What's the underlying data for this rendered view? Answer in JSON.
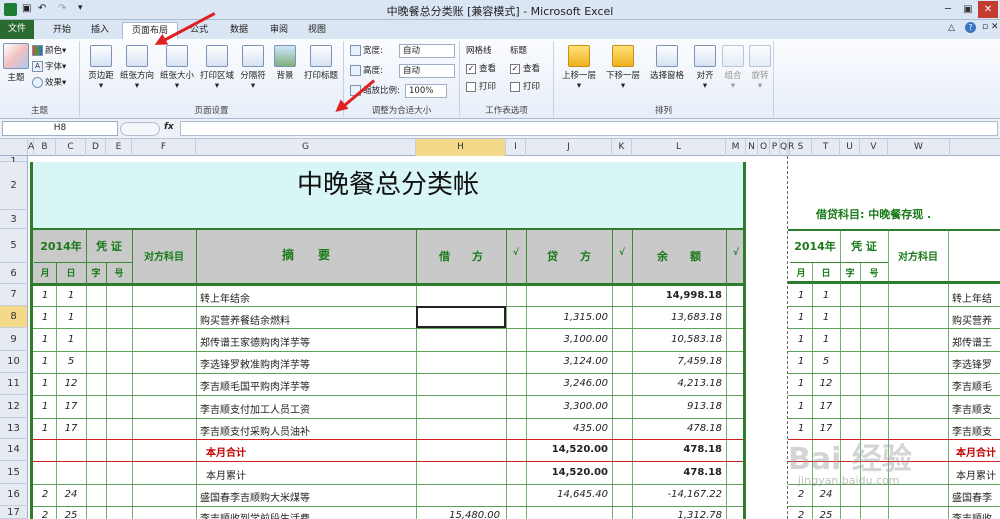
{
  "window": {
    "title": "中晚餐总分类账  [兼容模式]  -  Microsoft Excel"
  },
  "tabs": [
    "文件",
    "开始",
    "插入",
    "页面布局",
    "公式",
    "数据",
    "审阅",
    "视图"
  ],
  "ribbon": {
    "theme": {
      "big": "主题",
      "colors": "颜色",
      "fonts": "字体",
      "effects": "效果",
      "label": "主题"
    },
    "pagesetup": {
      "margins": "页边距",
      "orientation": "纸张方向",
      "size": "纸张大小",
      "printarea": "打印区域",
      "breaks": "分隔符",
      "background": "背景",
      "titles": "打印标题",
      "label": "页面设置"
    },
    "scale": {
      "width_label": "宽度:",
      "width_val": "自动",
      "height_label": "高度:",
      "height_val": "自动",
      "scale_label": "缩放比例:",
      "scale_val": "100%",
      "label": "调整为合适大小"
    },
    "sheetopts": {
      "grid": "网格线",
      "headings": "标题",
      "view1": "查看",
      "view2": "查看",
      "print1": "打印",
      "print2": "打印",
      "label": "工作表选项"
    },
    "arrange": {
      "up": "上移一层",
      "down": "下移一层",
      "pane": "选择窗格",
      "align": "对齐",
      "group": "组合",
      "rotate": "旋转",
      "label": "排列"
    }
  },
  "formula": {
    "namebox": "H8",
    "fx": "fx"
  },
  "columns": [
    "A",
    "B",
    "C",
    "D",
    "E",
    "F",
    "G",
    "H",
    "I",
    "J",
    "K",
    "L",
    "M",
    "N",
    "O",
    "P",
    "Q",
    "R",
    "S",
    "T",
    "U",
    "V",
    "W"
  ],
  "rows": [
    "1",
    "2",
    "3",
    "5",
    "6",
    "7",
    "8",
    "9",
    "10",
    "11",
    "12",
    "13",
    "14",
    "15",
    "16",
    "17"
  ],
  "sheet": {
    "title": "中晚餐总分类帐",
    "subject": "借贷科目:  中晚餐存现 .",
    "h_year": "2014年",
    "h_voucher": "凭 证",
    "h_counter": "对方科目",
    "h_summary": "摘　　要",
    "h_debit": "借　　方",
    "h_credit": "贷　　方",
    "h_balance": "余　　额",
    "h_check": "√",
    "h_month": "月",
    "h_day": "日",
    "h_zi": "字",
    "h_hao": "号",
    "r7": {
      "m": "1",
      "d": "1",
      "desc": "转上年结余",
      "bal": "14,998.18"
    },
    "r8": {
      "m": "1",
      "d": "1",
      "desc": "购买营养餐结余燃料",
      "cr": "1,315.00",
      "bal": "13,683.18"
    },
    "r9": {
      "m": "1",
      "d": "1",
      "desc": "郑传谱王家德购肉洋芋等",
      "cr": "3,100.00",
      "bal": "10,583.18"
    },
    "r10": {
      "m": "1",
      "d": "5",
      "desc": "李选锋罗敕准购肉洋芋等",
      "cr": "3,124.00",
      "bal": "7,459.18"
    },
    "r11": {
      "m": "1",
      "d": "12",
      "desc": "李吉顺毛国平购肉洋芋等",
      "cr": "3,246.00",
      "bal": "4,213.18"
    },
    "r12": {
      "m": "1",
      "d": "17",
      "desc": "李吉顺支付加工人员工资",
      "cr": "3,300.00",
      "bal": "913.18"
    },
    "r13": {
      "m": "1",
      "d": "17",
      "desc": "李吉顺支付采购人员油补",
      "cr": "435.00",
      "bal": "478.18"
    },
    "r14": {
      "desc": "本月合计",
      "cr": "14,520.00",
      "bal": "478.18"
    },
    "r15": {
      "desc": "本月累计",
      "cr": "14,520.00",
      "bal": "478.18"
    },
    "r16": {
      "m": "2",
      "d": "24",
      "desc": "盛国春李吉顺购大米煤等",
      "cr": "14,645.40",
      "bal": "-14,167.22"
    },
    "r17": {
      "m": "2",
      "d": "25",
      "desc": "李吉顺收到学前段生活费",
      "dr": "15,480.00",
      "bal": "1,312.78"
    },
    "right_desc": [
      "转上年结",
      "购买营养",
      "郑传谱王",
      "李选锋罗",
      "李吉顺毛",
      "李吉顺支",
      "李吉顺支",
      "本月合计",
      "本月累计",
      "盛国春李",
      "李吉顺收"
    ]
  },
  "watermark": {
    "brand": "Bai 经验",
    "url": "jingyan.baidu.com"
  }
}
